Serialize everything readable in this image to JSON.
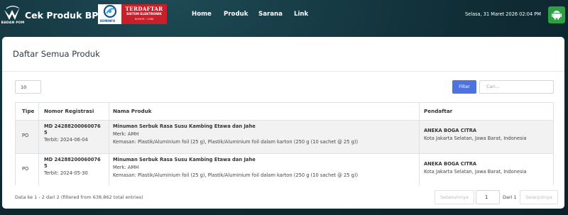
{
  "header": {
    "logo_caption": "BADAN POM",
    "brand": "Cek Produk BPOM",
    "badge": {
      "logo_text": "KOMINFO",
      "line1": "TERDAFTAR",
      "line2": "SISTEM ELEKTRONIK",
      "line3": "NOMOR : 2388"
    },
    "nav": [
      "Home",
      "Produk",
      "Sarana",
      "Link"
    ],
    "datetime": "Selasa, 31 Maret 2026 02:04 PM",
    "android_icon": "android-icon",
    "android_color": "#2ea043"
  },
  "card": {
    "title": "Daftar Semua Produk",
    "length_value": "10",
    "filter_label": "Filter",
    "search_placeholder": "Cari...",
    "accent": "#4e73df"
  },
  "table": {
    "columns": [
      "Tipe",
      "Nomor Registrasi",
      "Nama Produk",
      "Pendaftar"
    ],
    "rows": [
      {
        "tipe": "PO",
        "reg_line1": "MD 24288200060076",
        "reg_line2": "5",
        "terbit": "Terbit: 2024-06-04",
        "nama": "Minuman Serbuk Rasa Susu Kambing Etawa dan Jahe",
        "merk": "Merk: AMH",
        "kemasan": "Kemasan: Plastik/Aluminium foil (25 g), Plastik/Aluminium foil dalam karton (250 g (10 sachet @ 25 g))",
        "pendaftar": "ANEKA BOGA CITRA",
        "alamat": "Kota Jakarta Selatan, Jawa Barat, Indonesia"
      },
      {
        "tipe": "PO",
        "reg_line1": "MD 24288200060076",
        "reg_line2": "5",
        "terbit": "Terbit: 2024-05-30",
        "nama": "Minuman Serbuk Rasa Susu Kambing Etawa dan Jahe",
        "merk": "Merk: AMH",
        "kemasan": "Kemasan: Plastik/Aluminium foil (25 g), Plastik/Aluminium foil dalam karton (250 g (10 sachet @ 25 g))",
        "pendaftar": "ANEKA BOGA CITRA",
        "alamat": "Kota Jakarta Selatan, Jawa Barat, Indonesia"
      }
    ]
  },
  "footer": {
    "info": "Data ke 1 - 2 dari 2 (filtered from 638,862 total entries)",
    "prev_label": "Sebelumnya",
    "page_value": "1",
    "page_of": "Dari 1",
    "next_label": "Selanjutnya"
  }
}
